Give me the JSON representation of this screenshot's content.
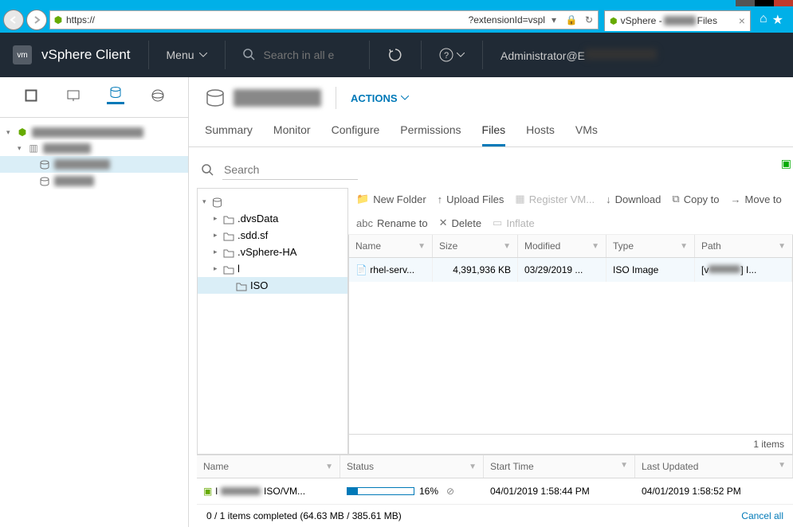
{
  "browser": {
    "url_prefix": "https://",
    "url_suffix": "?extensionId=vspl",
    "tab_prefix": "vSphere - ",
    "tab_suffix": "Files"
  },
  "masthead": {
    "brand_icon": "vm",
    "brand": "vSphere Client",
    "menu": "Menu",
    "search_placeholder": "Search in all e",
    "user_prefix": "Administrator@E"
  },
  "datastore": {
    "actions_label": "ACTIONS"
  },
  "tabs": [
    "Summary",
    "Monitor",
    "Configure",
    "Permissions",
    "Files",
    "Hosts",
    "VMs"
  ],
  "active_tab": "Files",
  "search_label": "Search",
  "folder_tree": [
    {
      "lvl": 0,
      "tog": "v",
      "name": "",
      "icon": "db"
    },
    {
      "lvl": 1,
      "tog": ">",
      "name": ".dvsData",
      "icon": "folder"
    },
    {
      "lvl": 1,
      "tog": ">",
      "name": ".sdd.sf",
      "icon": "folder"
    },
    {
      "lvl": 1,
      "tog": ">",
      "name": ".vSphere-HA",
      "icon": "folder"
    },
    {
      "lvl": 1,
      "tog": ">",
      "name": "l",
      "icon": "folder",
      "blurred": true
    },
    {
      "lvl": 2,
      "tog": "",
      "name": "ISO",
      "icon": "folder",
      "sel": true
    }
  ],
  "toolbar": [
    {
      "icon": "📁",
      "label": "New Folder",
      "dis": false
    },
    {
      "icon": "↑",
      "label": "Upload Files",
      "dis": false
    },
    {
      "icon": "▦",
      "label": "Register VM...",
      "dis": true
    },
    {
      "icon": "↓",
      "label": "Download",
      "dis": false
    },
    {
      "icon": "⧉",
      "label": "Copy to",
      "dis": false
    },
    {
      "icon": "→",
      "label": "Move to",
      "dis": false
    },
    {
      "icon": "abc",
      "label": "Rename to",
      "dis": false
    },
    {
      "icon": "✕",
      "label": "Delete",
      "dis": false
    },
    {
      "icon": "▭",
      "label": "Inflate",
      "dis": true
    }
  ],
  "grid": {
    "headers": [
      "Name",
      "Size",
      "Modified",
      "Type",
      "Path"
    ],
    "rows": [
      {
        "name": "rhel-serv...",
        "size": "4,391,936 KB",
        "modified": "03/29/2019 ...",
        "type": "ISO Image",
        "path_prefix": "[v",
        "path_suffix": "] I..."
      }
    ],
    "footer": "1 items"
  },
  "tasks": {
    "headers": [
      "Name",
      "Status",
      "Start Time",
      "Last Updated"
    ],
    "rows": [
      {
        "name_prefix": "l",
        "name_suffix": "ISO/VM...",
        "progress": 16,
        "progress_label": "16%",
        "start": "04/01/2019 1:58:44 PM",
        "updated": "04/01/2019 1:58:52 PM"
      }
    ],
    "footer": "0 / 1 items completed (64.63 MB / 385.61 MB)",
    "cancel": "Cancel all"
  }
}
